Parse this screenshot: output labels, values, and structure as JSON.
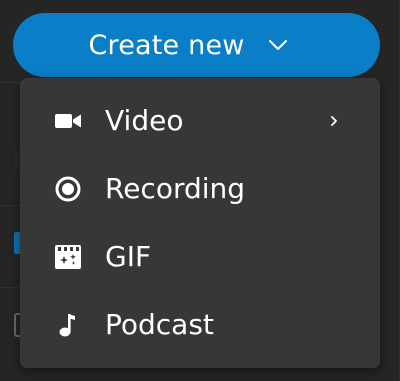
{
  "create_button": {
    "label": "Create new",
    "icon": "chevron-down-icon",
    "color": "#0a7fc7"
  },
  "menu": {
    "background": "#373737",
    "items": [
      {
        "label": "Video",
        "icon": "video-camera-icon",
        "has_submenu": true
      },
      {
        "label": "Recording",
        "icon": "record-icon",
        "has_submenu": false
      },
      {
        "label": "GIF",
        "icon": "gif-clapper-icon",
        "has_submenu": false
      },
      {
        "label": "Podcast",
        "icon": "music-note-icon",
        "has_submenu": false
      }
    ]
  }
}
